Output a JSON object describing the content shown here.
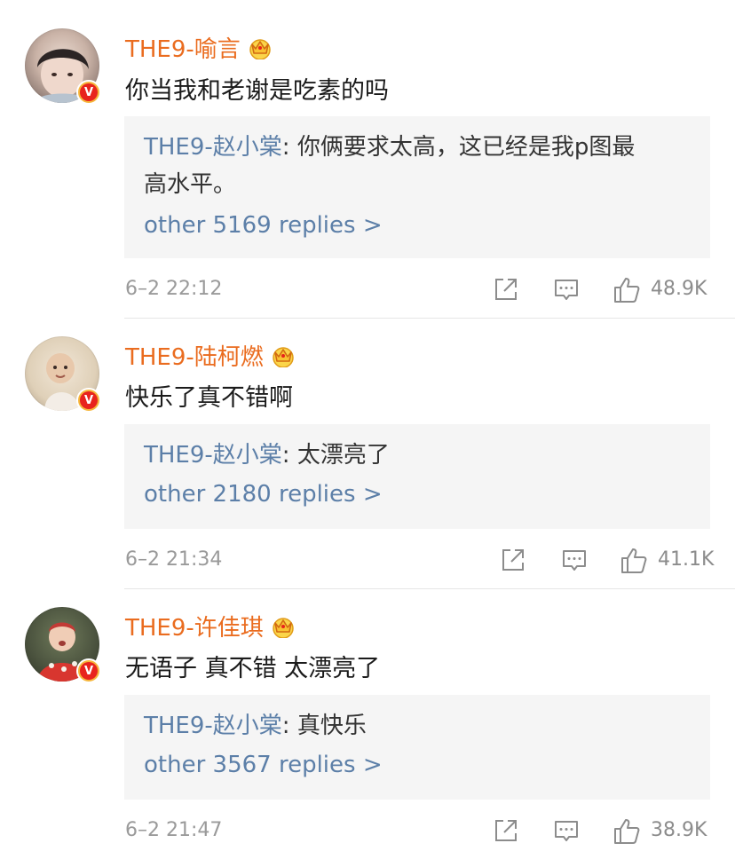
{
  "comments": [
    {
      "username": "THE9-喻言",
      "content": "你当我和老谢是吃素的吗",
      "reply_author": "THE9-赵小棠",
      "reply_sep": ": ",
      "reply_text_1": "你俩要求太高，这已经是我p图最",
      "reply_text_2": "高水平。",
      "more_replies": "other 5169 replies >",
      "time": "6–2 22:12",
      "likes": "48.9K"
    },
    {
      "username": "THE9-陆柯燃",
      "content": "快乐了真不错啊",
      "reply_author": "THE9-赵小棠",
      "reply_sep": ": ",
      "reply_text_1": "太漂亮了",
      "more_replies": "other 2180 replies >",
      "time": "6–2 21:34",
      "likes": "41.1K"
    },
    {
      "username": "THE9-许佳琪",
      "content": "无语子 真不错 太漂亮了",
      "reply_author": "THE9-赵小棠",
      "reply_sep": ": ",
      "reply_text_1": "真快乐",
      "more_replies": "other 3567 replies >",
      "time": "6–2 21:47",
      "likes": "38.9K"
    }
  ],
  "verified_badge": "V",
  "icons": {
    "crown": "crown-vip-icon",
    "share": "share-icon",
    "comment": "comment-icon",
    "like": "thumbs-up-icon"
  },
  "colors": {
    "username": "#ea6c1f",
    "reply_author": "#5c7fa8",
    "reply_bg": "#f5f5f5",
    "meta_text": "#9a9a9a",
    "verified_red": "#e8231d"
  }
}
